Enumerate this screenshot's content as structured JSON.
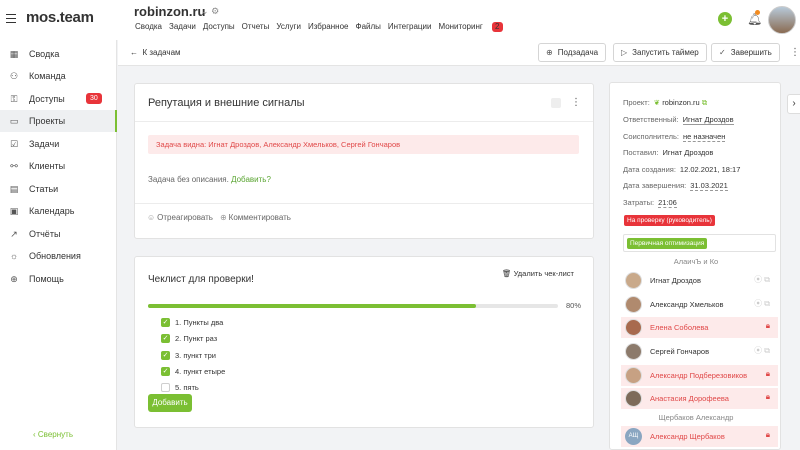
{
  "app": {
    "logo": "mos.team"
  },
  "project": {
    "title": "robinzon.ru",
    "nav": [
      "Сводка",
      "Задачи",
      "Доступы",
      "Отчеты",
      "Услуги",
      "Избранное",
      "Файлы",
      "Интеграции",
      "Мониторинг"
    ],
    "monitoring_badge": "2"
  },
  "sidebar": {
    "items": [
      {
        "label": "Сводка",
        "icon": "dashboard-icon"
      },
      {
        "label": "Команда",
        "icon": "team-icon"
      },
      {
        "label": "Доступы",
        "icon": "key-icon",
        "badge": "30"
      },
      {
        "label": "Проекты",
        "icon": "folder-icon"
      },
      {
        "label": "Задачи",
        "icon": "tasks-icon"
      },
      {
        "label": "Клиенты",
        "icon": "clients-icon"
      },
      {
        "label": "Статьи",
        "icon": "articles-icon"
      },
      {
        "label": "Календарь",
        "icon": "calendar-icon"
      },
      {
        "label": "Отчёты",
        "icon": "reports-icon"
      },
      {
        "label": "Обновления",
        "icon": "updates-icon"
      },
      {
        "label": "Помощь",
        "icon": "help-icon"
      }
    ],
    "collapse_label": "Свернуть"
  },
  "actionbar": {
    "back_label": "К задачам",
    "subtask_label": "Подзадача",
    "timer_label": "Запустить таймер",
    "complete_label": "Завершить"
  },
  "task": {
    "title": "Репутация и внешние сигналы",
    "visible_to": "Задача видна: Игнат Дроздов, Александр Хмельков, Сергей Гончаров",
    "no_description": "Задача без описания.",
    "add_link": "Добавить?",
    "react_label": "Отреагировать",
    "comment_label": "Комментировать"
  },
  "checklist": {
    "title": "Чеклист для проверки!",
    "delete_label": "Удалить чек-лист",
    "progress_percent": 80,
    "progress_label": "80%",
    "items": [
      {
        "text": "1.  Пункты два",
        "checked": true
      },
      {
        "text": "2.  Пункт раз",
        "checked": true
      },
      {
        "text": "3.  пункт три",
        "checked": true
      },
      {
        "text": "4.  пункт етыре",
        "checked": true
      },
      {
        "text": "5.  пять",
        "checked": false
      }
    ],
    "add_label": "Добавить"
  },
  "details": {
    "project_label": "Проект:",
    "project_value": "robinzon.ru",
    "responsible_label": "Ответственный:",
    "responsible_value": "Игнат Дроздов",
    "coexec_label": "Соисполнитель:",
    "coexec_value": "не назначен",
    "creator_label": "Поставил:",
    "creator_value": "Игнат Дроздов",
    "created_label": "Дата создания:",
    "created_value": "12.02.2021, 18:17",
    "due_label": "Дата завершения:",
    "due_value": "31.03.2021",
    "cost_label": "Затраты:",
    "cost_value": "21:06",
    "status_tag": "На проверку (руководитель)",
    "tag": "Первичная оптимизация"
  },
  "team": {
    "group1": "АлаичЪ и Ко",
    "group2": "Щербаков Александр",
    "people": [
      {
        "name": "Игнат Дроздов",
        "locked": false
      },
      {
        "name": "Александр Хмельков",
        "locked": false
      },
      {
        "name": "Елена Соболева",
        "locked": true
      },
      {
        "name": "Сергей Гончаров",
        "locked": false
      },
      {
        "name": "Александр Подберезовиков",
        "locked": true
      },
      {
        "name": "Анастасия Дорофеева",
        "locked": true
      }
    ],
    "last_person": {
      "name": "Александр Щербаков",
      "initials": "АЩ"
    }
  },
  "colors": {
    "accent": "#7bbf33",
    "danger": "#e8343a",
    "danger_bg": "#fdeaea"
  }
}
